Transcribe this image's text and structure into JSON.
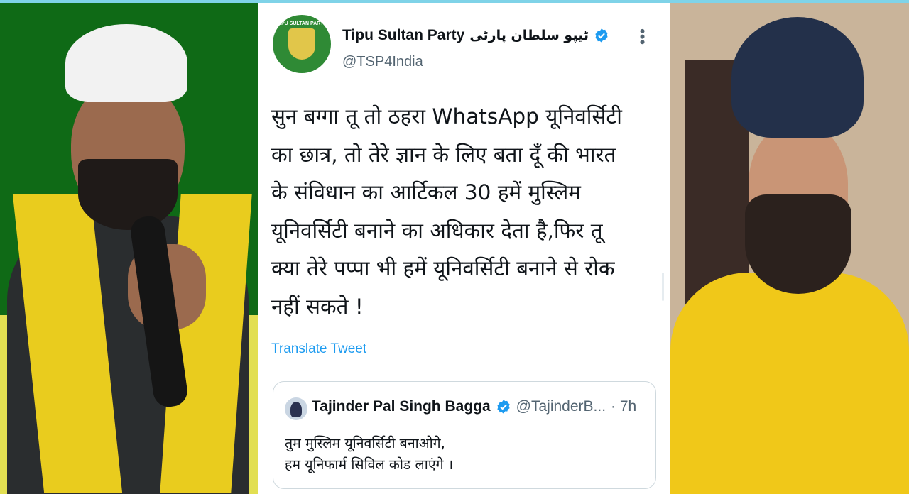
{
  "tweet": {
    "avatar_text": "TIPU SULTAN PARTY",
    "display_name": "Tipu Sultan Party",
    "urdu_name": "ٹیپو سلطان پارٹی",
    "handle": "@TSP4India",
    "more_label": "•••",
    "body_lines": [
      "सुन बग्गा तू तो ठहरा WhatsApp यूनिवर्सिटी",
      "का छात्र, तो तेरे ज्ञान के लिए बता दूँ की भारत",
      "के संविधान का आर्टिकल 30 हमें मुस्लिम",
      "यूनिवर्सिटी बनाने का अधिकार देता है,फिर तू",
      "क्या तेरे पप्पा भी हमें यूनिवर्सिटी बनाने से रोक",
      "नहीं सकते !"
    ],
    "translate_label": "Translate Tweet"
  },
  "quote": {
    "name": "Tajinder Pal Singh Bagga",
    "handle": "@TajinderB...",
    "time": "· 7h",
    "lines": [
      "तुम मुस्लिम यूनिवर्सिटी बनाओगे,",
      "हम यूनिफार्म सिविल कोड लाएंगे ।"
    ]
  },
  "icons": {
    "verified": "verified-badge-icon",
    "more": "more-options-icon"
  },
  "colors": {
    "accent": "#1d9bf0",
    "text": "#0f1419",
    "muted": "#536471",
    "left_bg": "#0f6a16",
    "scarf": "#e9cc1e",
    "shirt": "#f0c819"
  }
}
